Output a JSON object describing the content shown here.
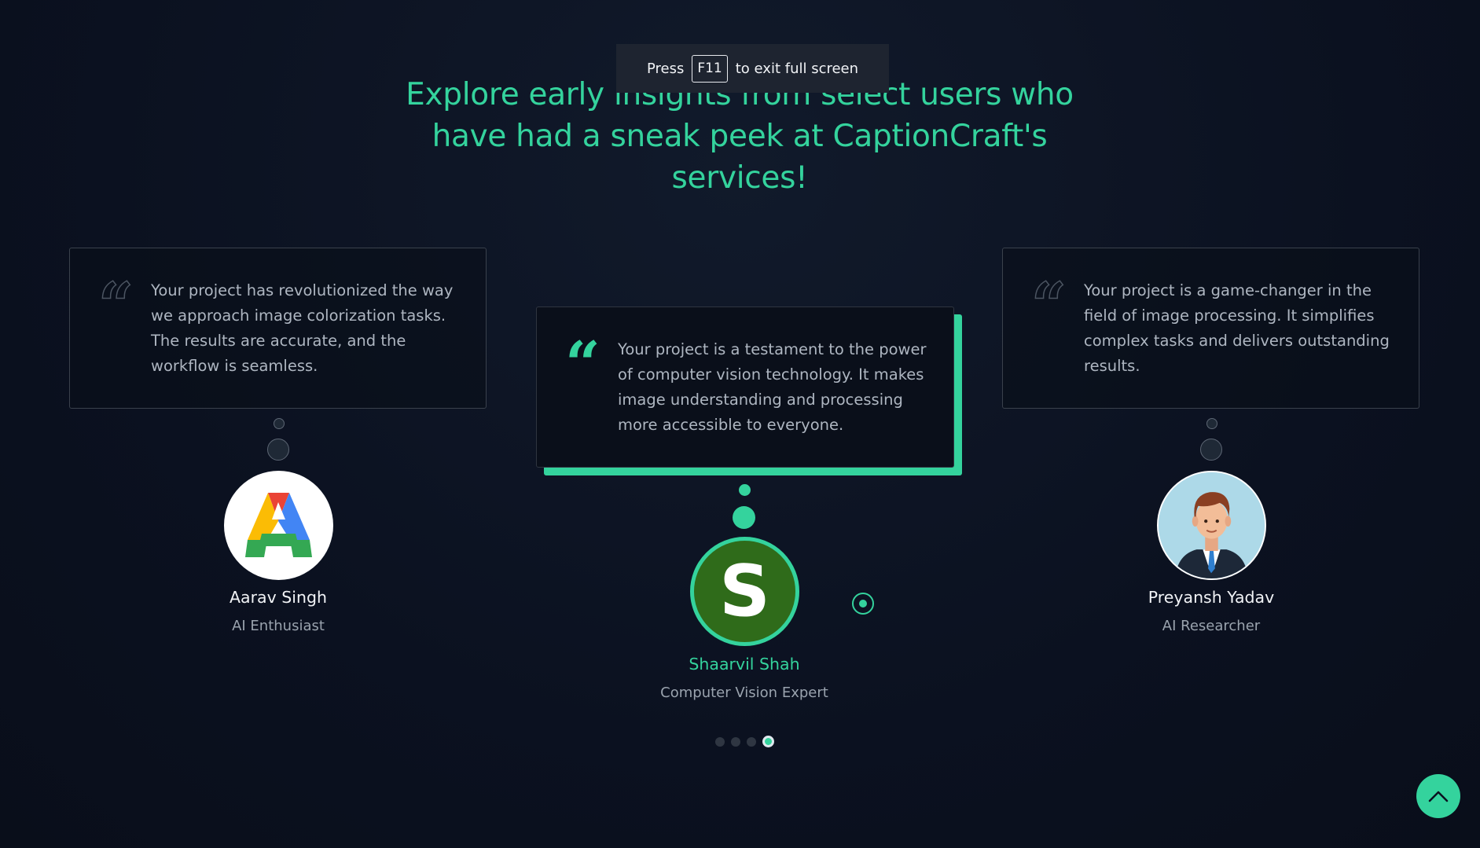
{
  "banner": {
    "press": "Press",
    "key": "F11",
    "message": "to exit full screen"
  },
  "heading": "Explore early insights from select users who have had a sneak peek at CaptionCraft's services!",
  "testimonials": [
    {
      "quote_icon": "quote-icon",
      "text": "Your project has revolutionized the way we approach image colorization tasks. The results are accurate, and the workflow is seamless.",
      "name": "Aarav Singh",
      "role": "AI Enthusiast",
      "avatar_icon": "letter-a-logo",
      "active": false
    },
    {
      "quote_icon": "quote-icon",
      "text": "Your project is a testament to the power of computer vision technology. It makes image understanding and processing more accessible to everyone.",
      "name": "Shaarvil Shah",
      "role": "Computer Vision Expert",
      "avatar_letter": "S",
      "active": true
    },
    {
      "quote_icon": "quote-icon",
      "text": "Your project is a game-changer in the field of image processing. It simplifies complex tasks and delivers outstanding results.",
      "name": "Preyansh Yadav",
      "role": "AI Researcher",
      "avatar_icon": "person-avatar",
      "active": false
    }
  ],
  "pagination": {
    "total": 4,
    "active_index": 3
  },
  "colors": {
    "accent": "#34d39d",
    "background": "#0b1120",
    "card_border": "#3a414c",
    "text_muted": "#aeb6c1",
    "avatar_center_bg": "#2f6b1a"
  },
  "icons": {
    "back_to_top": "chevron-up-icon",
    "slide_target": "radio-dot-icon"
  }
}
